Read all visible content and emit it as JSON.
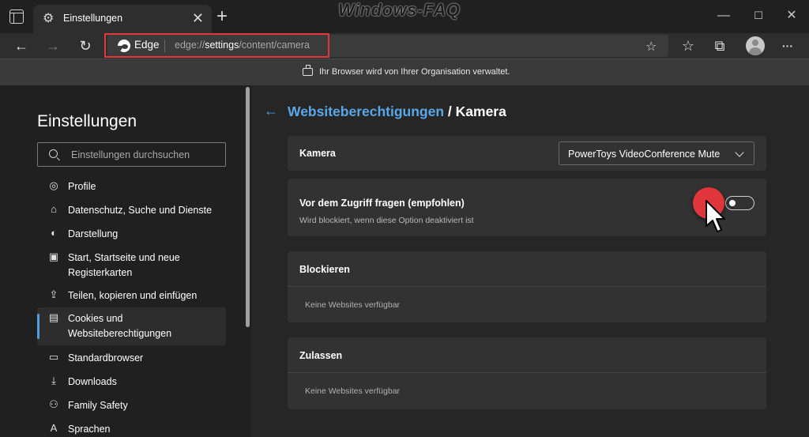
{
  "window": {
    "tab_title": "Einstellungen",
    "tab_close_glyph": "✕",
    "new_tab_glyph": "+",
    "watermark": "Windows-FAQ",
    "minimize_glyph": "—",
    "maximize_glyph": "☐",
    "close_glyph": "✕"
  },
  "toolbar": {
    "back_glyph": "←",
    "forward_glyph": "→",
    "refresh_glyph": "↻",
    "address_brand": "Edge",
    "url_prefix": "edge://",
    "url_host": "settings",
    "url_path": "/content/camera",
    "favorites_add_glyph": "☆",
    "favorites_glyph": "☆",
    "collections_glyph": "⧉",
    "more_glyph": "···"
  },
  "infobar": {
    "text": "Ihr Browser wird von Ihrer Organisation verwaltet."
  },
  "sidebar": {
    "title": "Einstellungen",
    "search_placeholder": "Einstellungen durchsuchen",
    "items": [
      {
        "label": "Profile",
        "icon": "◎"
      },
      {
        "label": "Datenschutz, Suche und Dienste",
        "icon": "⌂"
      },
      {
        "label": "Darstellung",
        "icon": "◐"
      },
      {
        "label": "Start, Startseite und neue Registerkarten",
        "icon": "▣"
      },
      {
        "label": "Teilen, kopieren und einfügen",
        "icon": "⇪"
      },
      {
        "label": "Cookies und Websiteberechtigungen",
        "icon": "▤"
      },
      {
        "label": "Standardbrowser",
        "icon": "▭"
      },
      {
        "label": "Downloads",
        "icon": "⤓"
      },
      {
        "label": "Family Safety",
        "icon": "⚇"
      },
      {
        "label": "Sprachen",
        "icon": "A"
      }
    ]
  },
  "main": {
    "back_glyph": "←",
    "breadcrumb_link": "Websiteberechtigungen",
    "breadcrumb_sep": " / ",
    "breadcrumb_current": "Kamera",
    "camera_label": "Kamera",
    "camera_device": "PowerToys VideoConference Mute",
    "ask_label": "Vor dem Zugriff fragen (empfohlen)",
    "ask_sub": "Wird blockiert, wenn diese Option deaktiviert ist",
    "ask_enabled": false,
    "block_label": "Blockieren",
    "block_empty": "Keine Websites verfügbar",
    "allow_label": "Zulassen",
    "allow_empty": "Keine Websites verfügbar"
  },
  "colors": {
    "accent": "#5aa7e8",
    "highlight_box": "#e0383c",
    "click_indicator": "#e0353b"
  }
}
